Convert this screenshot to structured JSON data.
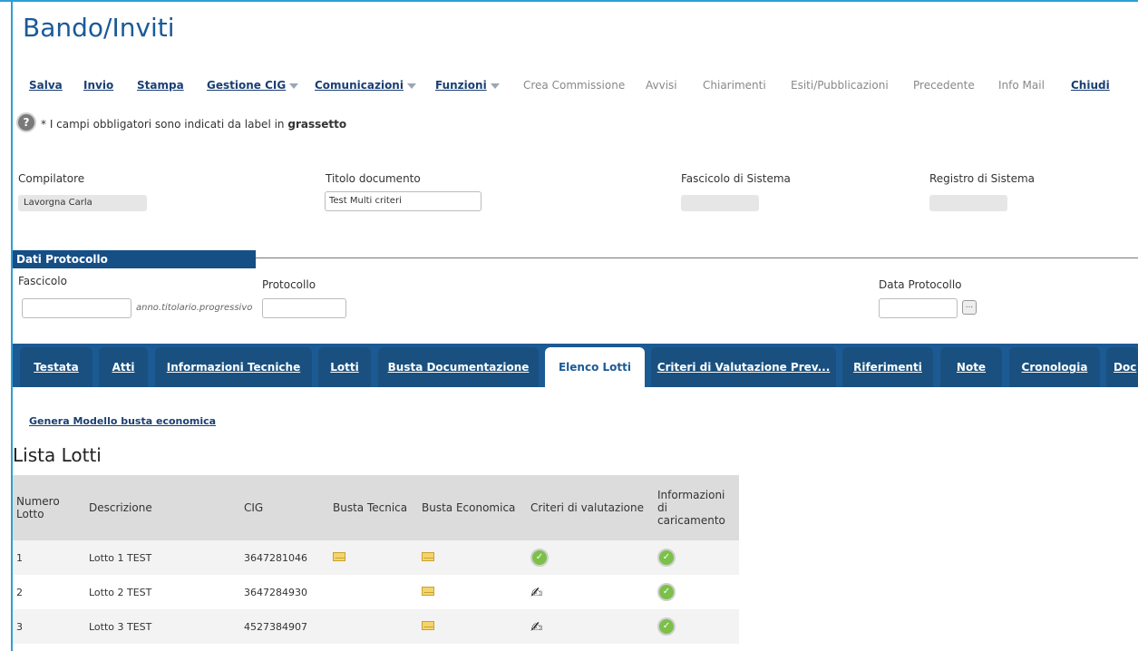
{
  "title": "Bando/Inviti",
  "toolbar": {
    "salva": "Salva",
    "invio": "Invio",
    "stampa": "Stampa",
    "gestione_cig": "Gestione CIG",
    "comunicazioni": "Comunicazioni",
    "funzioni": "Funzioni",
    "crea_commissione": "Crea Commissione",
    "avvisi": "Avvisi",
    "chiarimenti": "Chiarimenti",
    "esiti": "Esiti/Pubblicazioni",
    "precedente": "Precedente",
    "info_mail": "Info Mail",
    "chiudi": "Chiudi"
  },
  "notice": {
    "text": "* I campi obbligatori sono indicati da label in",
    "bold": "grassetto"
  },
  "fields": {
    "compilatore_label": "Compilatore",
    "compilatore_value": "Lavorgna Carla",
    "titolo_label": "Titolo documento",
    "titolo_value": "Test Multi criteri",
    "fascicolo_sistema_label": "Fascicolo di Sistema",
    "registro_sistema_label": "Registro di Sistema"
  },
  "protocollo": {
    "section_title": "Dati Protocollo",
    "fascicolo_label": "Fascicolo",
    "fascicolo_hint": "anno.titolario.progressivo",
    "protocollo_label": "Protocollo",
    "data_label": "Data Protocollo",
    "dots": "..."
  },
  "tabs": {
    "testata": "Testata",
    "atti": "Atti",
    "info_tecniche": "Informazioni Tecniche",
    "lotti": "Lotti",
    "busta_doc": "Busta Documentazione",
    "elenco_lotti": "Elenco Lotti",
    "criteri": "Criteri di Valutazione Prev...",
    "riferimenti": "Riferimenti",
    "note": "Note",
    "cronologia": "Cronologia",
    "doc": "Doc"
  },
  "genera_link": "Genera Modello busta economica",
  "list_title": "Lista Lotti",
  "table": {
    "headers": {
      "numero": "Numero Lotto",
      "descrizione": "Descrizione",
      "cig": "CIG",
      "busta_tecnica": "Busta Tecnica",
      "busta_economica": "Busta Economica",
      "criteri": "Criteri di valutazione",
      "info": "Informazioni di caricamento"
    },
    "rows": [
      {
        "numero": "1",
        "descrizione": "Lotto 1 TEST",
        "cig": "3647281046"
      },
      {
        "numero": "2",
        "descrizione": "Lotto 2 TEST",
        "cig": "3647284930"
      },
      {
        "numero": "3",
        "descrizione": "Lotto 3 TEST",
        "cig": "4527384907"
      }
    ]
  },
  "colors": {
    "accent": "#1a5a98",
    "tab_bar": "#1c5a94",
    "section": "#164e86",
    "frame": "#2b9fd6"
  }
}
